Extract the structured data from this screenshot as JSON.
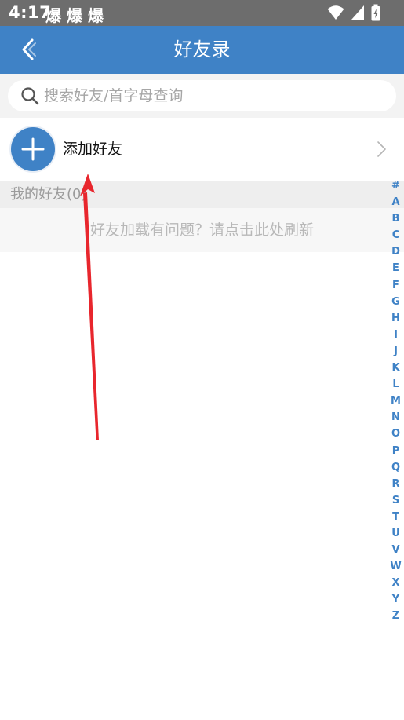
{
  "status_bar": {
    "time": "4:17",
    "notifications": [
      "爆",
      "爆",
      "爆"
    ]
  },
  "header": {
    "title": "好友录",
    "back_icon": "chevron-left-icon"
  },
  "search": {
    "placeholder": "搜索好友/首字母查询",
    "value": "",
    "icon": "search-icon"
  },
  "add_friend": {
    "label": "添加好友",
    "icon": "plus-icon"
  },
  "friends_section": {
    "title": "我的好友(0)",
    "reload_message": "好友加载有问题？请点击此处刷新"
  },
  "alphabet_index": [
    "#",
    "A",
    "B",
    "C",
    "D",
    "E",
    "F",
    "G",
    "H",
    "I",
    "J",
    "K",
    "L",
    "M",
    "N",
    "O",
    "P",
    "Q",
    "R",
    "S",
    "T",
    "U",
    "V",
    "W",
    "X",
    "Y",
    "Z"
  ],
  "colors": {
    "primary": "#3f82c6",
    "status_bar": "#6d6d6d",
    "annotation_arrow": "#e8262d"
  }
}
